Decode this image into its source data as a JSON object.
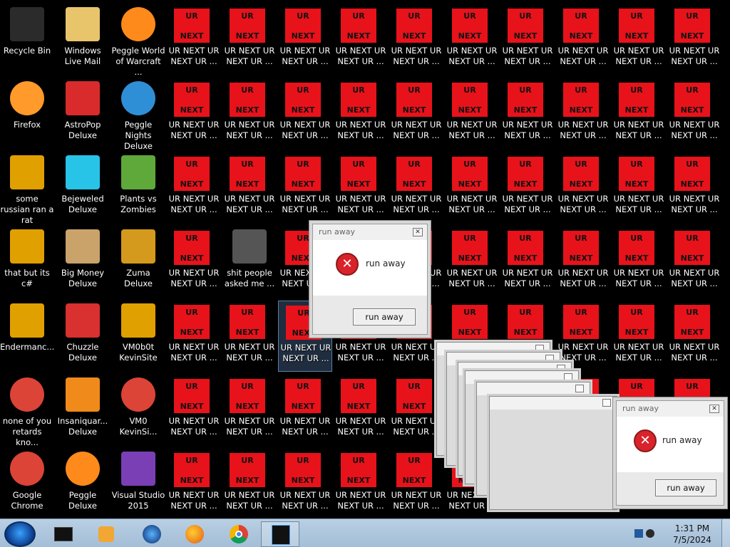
{
  "desktop": {
    "icons": [
      {
        "label": "Recycle Bin",
        "kind": "recycle-bin-icon"
      },
      {
        "label": "Windows Live Mail",
        "kind": "mail-icon"
      },
      {
        "label": "Peggle World of Warcraft ...",
        "kind": "peggle-icon"
      },
      {
        "label": "Firefox",
        "kind": "firefox-icon"
      },
      {
        "label": "AstroPop Deluxe",
        "kind": "astropop-icon"
      },
      {
        "label": "Peggle Nights Deluxe",
        "kind": "peggle-nights-icon"
      },
      {
        "label": "some russian ran a rat",
        "kind": "app-icon"
      },
      {
        "label": "Bejeweled Deluxe",
        "kind": "bejeweled-icon"
      },
      {
        "label": "Plants vs Zombies",
        "kind": "plants-vs-zombies-icon"
      },
      {
        "label": "that but its c#",
        "kind": "app-icon"
      },
      {
        "label": "Big Money Deluxe",
        "kind": "big-money-icon"
      },
      {
        "label": "Zuma Deluxe",
        "kind": "zuma-icon"
      },
      {
        "label": "shit people asked me ...",
        "kind": "folder-icon"
      },
      {
        "label": "Endermanc...",
        "kind": "app-icon"
      },
      {
        "label": "Chuzzle Deluxe",
        "kind": "chuzzle-icon"
      },
      {
        "label": "VM0b0t KevinSite",
        "kind": "app-icon"
      },
      {
        "label": "none of you retards kno...",
        "kind": "chrome-icon"
      },
      {
        "label": "Insaniquar... Deluxe",
        "kind": "insaniquarium-icon"
      },
      {
        "label": "VM0 KevinSi...",
        "kind": "chrome-icon"
      },
      {
        "label": "Google Chrome",
        "kind": "chrome-icon"
      },
      {
        "label": "Peggle Deluxe",
        "kind": "peggle-icon"
      },
      {
        "label": "Visual Studio 2015",
        "kind": "visual-studio-icon"
      }
    ],
    "ur_icon": {
      "top": "UR",
      "bottom": "NEXT",
      "label": "UR NEXT UR NEXT UR ..."
    }
  },
  "dialog_main": {
    "title": "run away",
    "message": "run away",
    "button": "run away"
  },
  "dialog_front": {
    "title": "run away",
    "message": "run away",
    "button": "run away"
  },
  "taskbar": {
    "items": [
      "start-orb-icon",
      "app-window-icon",
      "media-player-icon",
      "globe-icon",
      "firefox-icon",
      "chrome-icon",
      "active-window-icon"
    ],
    "time": "1:31 PM",
    "date": "7/5/2024"
  }
}
